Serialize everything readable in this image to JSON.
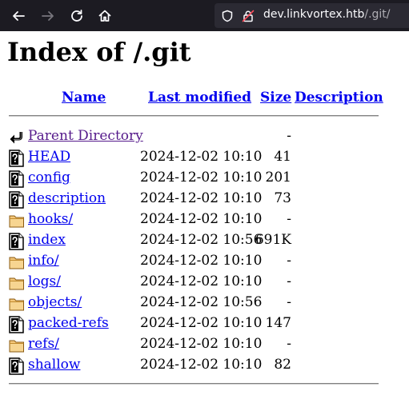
{
  "browser": {
    "url_domain": "dev.linkvortex.htb",
    "url_path": "/.git/"
  },
  "page": {
    "title": "Index of /.git"
  },
  "table": {
    "headers": {
      "name": "Name",
      "last_modified": "Last modified",
      "size": "Size",
      "description": "Description"
    },
    "parent": {
      "label": "Parent Directory",
      "size": "-"
    },
    "rows": [
      {
        "name": "HEAD",
        "modified": "2024-12-02 10:10",
        "size": "41",
        "icon": "unknown-file-icon"
      },
      {
        "name": "config",
        "modified": "2024-12-02 10:10",
        "size": "201",
        "icon": "unknown-file-icon"
      },
      {
        "name": "description",
        "modified": "2024-12-02 10:10",
        "size": "73",
        "icon": "unknown-file-icon"
      },
      {
        "name": "hooks/",
        "modified": "2024-12-02 10:10",
        "size": "-",
        "icon": "folder-icon"
      },
      {
        "name": "index",
        "modified": "2024-12-02 10:56",
        "size": "691K",
        "icon": "unknown-file-icon"
      },
      {
        "name": "info/",
        "modified": "2024-12-02 10:10",
        "size": "-",
        "icon": "folder-icon"
      },
      {
        "name": "logs/",
        "modified": "2024-12-02 10:10",
        "size": "-",
        "icon": "folder-icon"
      },
      {
        "name": "objects/",
        "modified": "2024-12-02 10:56",
        "size": "-",
        "icon": "folder-icon"
      },
      {
        "name": "packed-refs",
        "modified": "2024-12-02 10:10",
        "size": "147",
        "icon": "unknown-file-icon"
      },
      {
        "name": "refs/",
        "modified": "2024-12-02 10:10",
        "size": "-",
        "icon": "folder-icon"
      },
      {
        "name": "shallow",
        "modified": "2024-12-02 10:10",
        "size": "82",
        "icon": "unknown-file-icon"
      }
    ]
  },
  "colors": {
    "link": "#0000ee",
    "visited_link": "#551a8b",
    "toolbar": "#1c1b22",
    "urlbar": "#2b2a33"
  }
}
